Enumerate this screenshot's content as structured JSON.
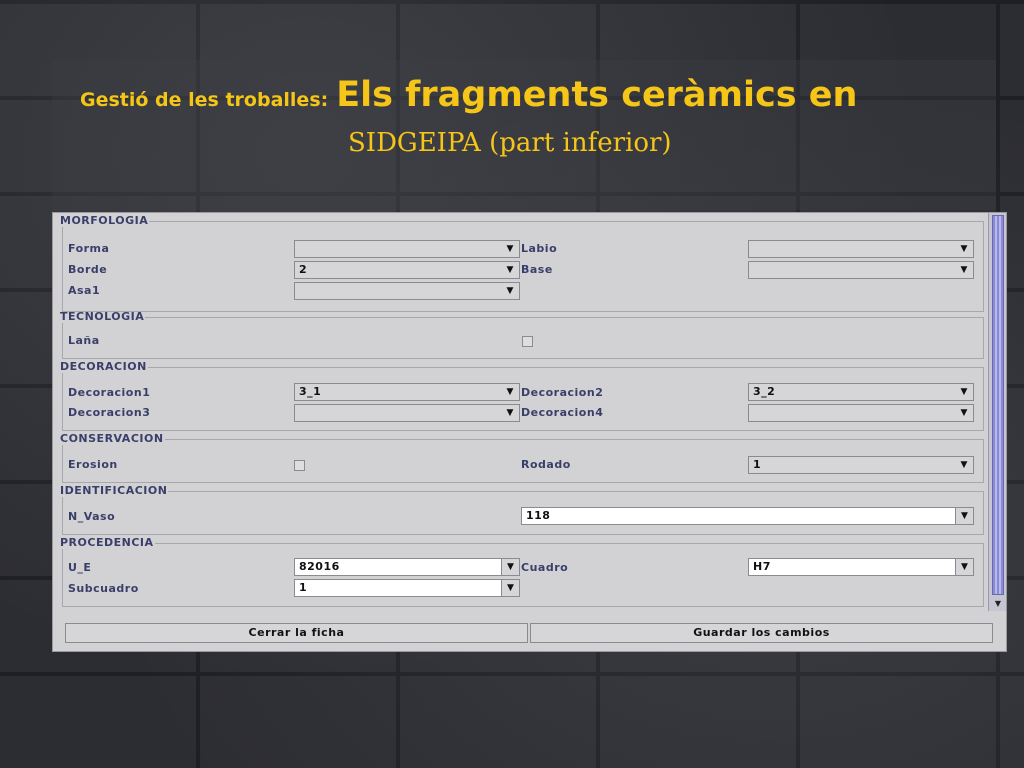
{
  "slide": {
    "title_small": "Gestió de les troballes:",
    "title_big": "Els fragments ceràmics en",
    "title_line2": "SIDGEIPA (part inferior)"
  },
  "form": {
    "morfologia": {
      "legend": "MORFOLOGIA",
      "forma_label": "Forma",
      "forma_value": "",
      "labio_label": "Labio",
      "labio_value": "",
      "borde_label": "Borde",
      "borde_value": "2",
      "base_label": "Base",
      "base_value": "",
      "asa1_label": "Asa1",
      "asa1_value": ""
    },
    "tecnologia": {
      "legend": "TECNOLOGIA",
      "lana_label": "Laña",
      "lana_checked": false
    },
    "decoracion": {
      "legend": "DECORACION",
      "dec1_label": "Decoracion1",
      "dec1_value": "3_1",
      "dec2_label": "Decoracion2",
      "dec2_value": "3_2",
      "dec3_label": "Decoracion3",
      "dec3_value": "",
      "dec4_label": "Decoracion4",
      "dec4_value": ""
    },
    "conservacion": {
      "legend": "CONSERVACION",
      "erosion_label": "Erosion",
      "erosion_checked": false,
      "rodado_label": "Rodado",
      "rodado_value": "1"
    },
    "identificacion": {
      "legend": "IDENTIFICACION",
      "nvaso_label": "N_Vaso",
      "nvaso_value": "118"
    },
    "procedencia": {
      "legend": "PROCEDENCIA",
      "ue_label": "U_E",
      "ue_value": "82016",
      "cuadro_label": "Cuadro",
      "cuadro_value": "H7",
      "subcuadro_label": "Subcuadro",
      "subcuadro_value": "1"
    }
  },
  "buttons": {
    "close_label": "Cerrar la ficha",
    "save_label": "Guardar los cambios"
  },
  "icons": {
    "dropdown": "chevron-down-icon",
    "scroll_down": "arrow-down-icon"
  },
  "colors": {
    "title": "#f5c518",
    "label_text": "#3a3f6a",
    "window_bg": "#d2d2d4",
    "scroll_thumb": "#8a8ad6"
  }
}
